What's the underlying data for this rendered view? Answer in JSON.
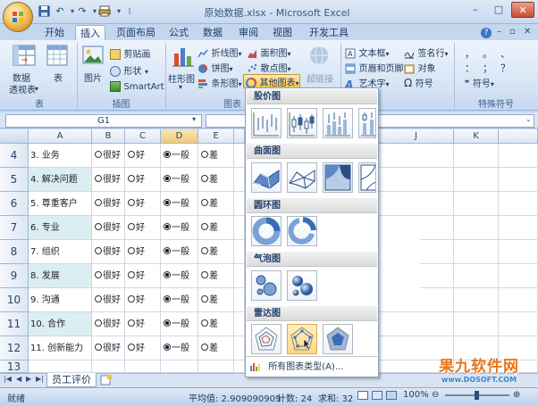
{
  "window": {
    "title": "原始数据.xlsx - Microsoft Excel",
    "minimize": "–",
    "restore": "□",
    "close": "✕"
  },
  "ribbon_tabs": [
    "开始",
    "插入",
    "页面布局",
    "公式",
    "数据",
    "审阅",
    "视图",
    "开发工具"
  ],
  "active_tab": "插入",
  "ribbon": {
    "groups": {
      "table": "表",
      "illustrations": "插图",
      "charts": "图表",
      "special": "特殊符号"
    },
    "pivot_label": "数据\n透视表",
    "pivot_line1": "数据",
    "pivot_line2": "透视表",
    "table_label": "表",
    "picture_label": "图片",
    "clipart_label": "剪贴画",
    "shapes_label": "形状",
    "smartart_label": "SmartArt",
    "column_label": "柱形图",
    "line_label": "折线图",
    "pie_label": "饼图",
    "bar_label": "条形图",
    "area_label": "面积图",
    "scatter_label": "散点图",
    "other_label": "其他图表",
    "hyperlink_label": "超链接",
    "textbox_label": "文本框",
    "headerfooter_label": "页眉和页脚",
    "wordart_label": "艺术字",
    "signature_label": "签名行",
    "object_label": "对象",
    "symbol_label": "符号",
    "special_symbol_label": "符号",
    "special_glyphs": [
      "，",
      "。",
      "、",
      "：",
      "；",
      "？"
    ]
  },
  "formula_bar": {
    "name_box": "G1",
    "fx": "fx"
  },
  "columns": [
    "A",
    "B",
    "C",
    "D",
    "E",
    "J",
    "K"
  ],
  "rows": [
    {
      "num": "4",
      "label": "3. 业务",
      "opts": [
        "○很好",
        "○好",
        "●一般",
        "○差"
      ]
    },
    {
      "num": "5",
      "label": "4. 解决问题",
      "opts": [
        "○很好",
        "○好",
        "●一般",
        "○差"
      ]
    },
    {
      "num": "6",
      "label": "5. 尊重客户",
      "opts": [
        "○很好",
        "○好",
        "●一般",
        "○差"
      ]
    },
    {
      "num": "7",
      "label": "6. 专业",
      "opts": [
        "○很好",
        "○好",
        "●一般",
        "○差"
      ]
    },
    {
      "num": "8",
      "label": "7. 组织",
      "opts": [
        "○很好",
        "○好",
        "●一般",
        "○差"
      ]
    },
    {
      "num": "9",
      "label": "8. 发展",
      "opts": [
        "○很好",
        "○好",
        "●一般",
        "○差"
      ]
    },
    {
      "num": "10",
      "label": "9. 沟通",
      "opts": [
        "○很好",
        "○好",
        "●一般",
        "○差"
      ]
    },
    {
      "num": "11",
      "label": "10. 合作",
      "opts": [
        "○很好",
        "○好",
        "●一般",
        "○差"
      ]
    },
    {
      "num": "12",
      "label": "11. 创新能力",
      "opts": [
        "○很好",
        "○好",
        "●一般",
        "○差"
      ]
    },
    {
      "num": "13",
      "label": "",
      "opts": []
    },
    {
      "num": "14",
      "label": "",
      "opts": []
    }
  ],
  "dropdown": {
    "sections": [
      "股价图",
      "曲面图",
      "圆环图",
      "气泡图",
      "雷达图"
    ],
    "all_types": "所有图表类型(A)..."
  },
  "sheet_tab": "员工评价",
  "status": {
    "ready": "就绪",
    "average": "平均值: 2.909090909",
    "count": "计数: 24",
    "sum": "求和: 32",
    "zoom": "100%"
  },
  "watermark": {
    "brand": "果九软件网",
    "url": "www.DOSOFT.COM"
  },
  "colors": {
    "accent": "#1e395b",
    "ribbon_bg": "#d5e3f4",
    "alt_row": "#dbeef2",
    "selected_thumb": "#ffd880"
  }
}
